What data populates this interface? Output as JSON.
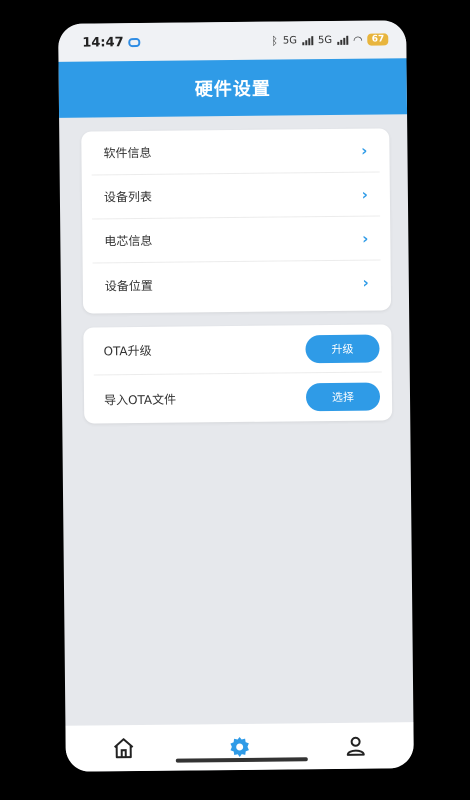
{
  "status_bar": {
    "time": "14:47",
    "network_1": "5G",
    "network_2": "5G",
    "battery": "67"
  },
  "header": {
    "title": "硬件设置"
  },
  "menu_card": {
    "items": [
      {
        "label": "软件信息"
      },
      {
        "label": "设备列表"
      },
      {
        "label": "电芯信息"
      },
      {
        "label": "设备位置"
      }
    ]
  },
  "ota_card": {
    "upgrade_label": "OTA升级",
    "upgrade_button": "升级",
    "import_label": "导入OTA文件",
    "import_button": "选择"
  },
  "bottom_nav": {
    "items": [
      {
        "icon": "home-icon"
      },
      {
        "icon": "gear-icon",
        "active": true
      },
      {
        "icon": "user-icon"
      }
    ]
  },
  "colors": {
    "accent": "#2f9be7",
    "background": "#e6e8ec",
    "battery": "#e8b53d"
  }
}
